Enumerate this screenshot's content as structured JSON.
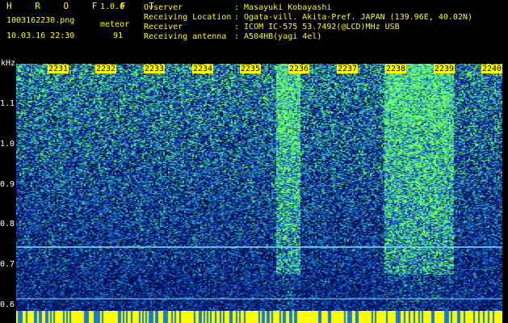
{
  "header": {
    "app_title": "H R O F F T",
    "version": "1.0.0",
    "filename": "1003162230.png",
    "datetime": "10.03.16 22:30",
    "meteor_label": "meteor",
    "meteor_count": "91",
    "info": [
      {
        "key": "Ovserver",
        "value": ": Masayuki Kobayashi"
      },
      {
        "key": "Receiving Location",
        "value": ": Ogata-vill. Akita-Pref. JAPAN (139.96E, 40.02N)"
      },
      {
        "key": "Receiver",
        "value": ": ICOM IC-575 53.7492(@LCD)MHz USB"
      },
      {
        "key": "Receiving antenna",
        "value": ": A504HB(yagi 4el)"
      }
    ]
  },
  "spectrogram": {
    "y_unit": "kHz",
    "y_ticks": [
      "1.1",
      "1.0",
      "0.9",
      "0.8",
      "0.7",
      "0.6"
    ],
    "time_labels": [
      "2231",
      "2232",
      "2233",
      "2234",
      "2235",
      "2236",
      "2237",
      "2238",
      "2239",
      "2240"
    ],
    "colors": {
      "background": "#041050",
      "noise_low": "#0a2aa0",
      "noise_mid": "#1a7ad0",
      "noise_high": "#3cd0a0",
      "burst": "#70ff60",
      "hline": "#7fe0ff",
      "bottom_bar": "#ffff00"
    }
  }
}
